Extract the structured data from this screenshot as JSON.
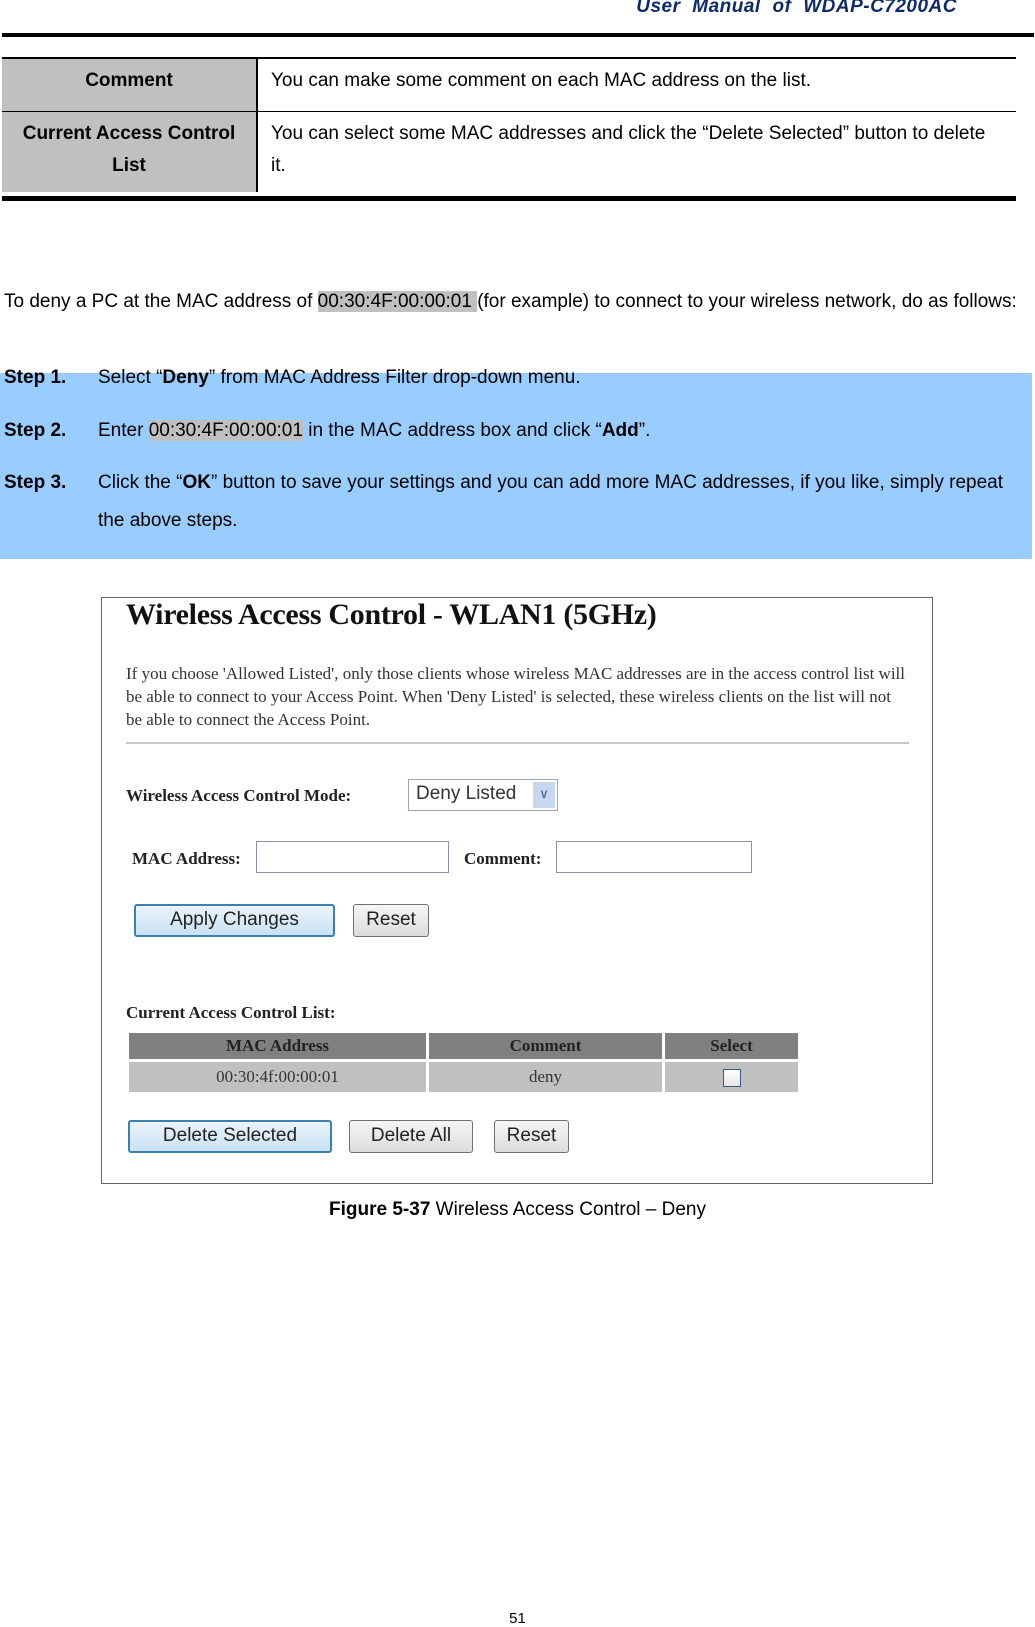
{
  "header": {
    "title": "User  Manual  of  WDAP-C7200AC"
  },
  "definition_table": {
    "rows": [
      {
        "term": "Comment",
        "description": "You can make some comment on each MAC address on the list."
      },
      {
        "term": "Current Access Control List",
        "description": "You can select some MAC addresses and click the “Delete Selected” button to delete it."
      }
    ]
  },
  "intro": {
    "before": "To deny a PC at the MAC address of ",
    "mac": "00:30:4F:00:00:01 ",
    "after": "(for example) to connect to your wireless network, do as follows:"
  },
  "steps": [
    {
      "label": "Step 1.",
      "pre": "Select “",
      "bold": "Deny",
      "post": "” from MAC Address Filter drop-down menu."
    },
    {
      "label": "Step 2.",
      "pre": "Enter ",
      "highlight": "00:30:4F:00:00:01",
      "mid": " in the MAC address box and click “",
      "bold": "Add",
      "post": "”."
    },
    {
      "label": "Step 3.",
      "pre": "Click the “",
      "bold": "OK",
      "post": "” button to save your settings and you can add more MAC addresses, if you like, simply repeat the above steps."
    }
  ],
  "screenshot": {
    "title": "Wireless Access Control - WLAN1 (5GHz)",
    "description": "If you choose 'Allowed Listed', only those clients whose wireless MAC addresses are in the access control list will be able to connect to your Access Point. When 'Deny Listed' is selected, these wireless clients on the list will not be able to connect the Access Point.",
    "mode_label": "Wireless Access Control Mode:",
    "mode_value": "Deny Listed",
    "mac_label": "MAC Address:",
    "mac_value": "",
    "comment_label": "Comment:",
    "comment_value": "",
    "apply_button": "Apply Changes",
    "reset_button": "Reset",
    "list_title": "Current Access Control List:",
    "columns": [
      "MAC Address",
      "Comment",
      "Select"
    ],
    "rows": [
      {
        "mac": "00:30:4f:00:00:01",
        "comment": "deny",
        "selected": false
      }
    ],
    "delete_selected_button": "Delete Selected",
    "delete_all_button": "Delete All",
    "reset_list_button": "Reset"
  },
  "caption": {
    "label": "Figure 5-37",
    "text": " Wireless Access Control – Deny"
  },
  "page_number": "51"
}
